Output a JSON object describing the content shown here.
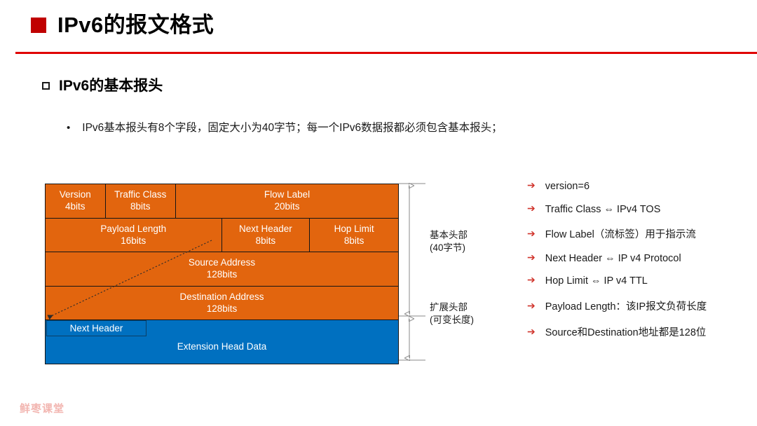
{
  "slide": {
    "title": "IPv6的报文格式",
    "subheading": "IPv6的基本报头",
    "bullet": "IPv6基本报头有8个字段，固定大小为40字节；每一个IPv6数据报都必须包含基本报头；",
    "bullet_marker": "•",
    "footer_logo": "鲜枣课堂"
  },
  "colors": {
    "title_marker": "#C00000",
    "title_rule": "#E00000",
    "header_orange": "#E2650E",
    "extension_blue": "#0070C0",
    "note_arrow_red": "#D0342C",
    "footer_pink": "#F2B5B0"
  },
  "diagram": {
    "rows": [
      {
        "cells": [
          {
            "name": "Version",
            "bits": "4bits",
            "width_pct": 17
          },
          {
            "name": "Traffic Class",
            "bits": "8bits",
            "width_pct": 20
          },
          {
            "name": "Flow Label",
            "bits": "20bits",
            "width_pct": 63
          }
        ]
      },
      {
        "cells": [
          {
            "name": "Payload Length",
            "bits": "16bits",
            "width_pct": 50
          },
          {
            "name": "Next Header",
            "bits": "8bits",
            "width_pct": 25
          },
          {
            "name": "Hop Limit",
            "bits": "8bits",
            "width_pct": 25
          }
        ]
      },
      {
        "cells": [
          {
            "name": "Source Address",
            "bits": "128bits",
            "width_pct": 100
          }
        ]
      },
      {
        "cells": [
          {
            "name": "Destination Address",
            "bits": "128bits",
            "width_pct": 100
          }
        ]
      }
    ],
    "extension": {
      "next_header_label": "Next Header",
      "data_label": "Extension Head Data"
    },
    "measures": [
      {
        "label_line1": "基本头部",
        "label_line2": "(40字节)"
      },
      {
        "label_line1": "扩展头部",
        "label_line2": "(可变长度)"
      }
    ]
  },
  "notes": {
    "arrow_glyph": "➔",
    "items": [
      "version=6",
      "Traffic Class ⇔ IPv4 TOS",
      "Flow Label（流标签）用于指示流",
      "Next Header ⇔ IP v4 Protocol",
      "Hop Limit ⇔ IP v4 TTL",
      "Payload Length：该IP报文负荷长度",
      "Source和Destination地址都是128位"
    ]
  }
}
